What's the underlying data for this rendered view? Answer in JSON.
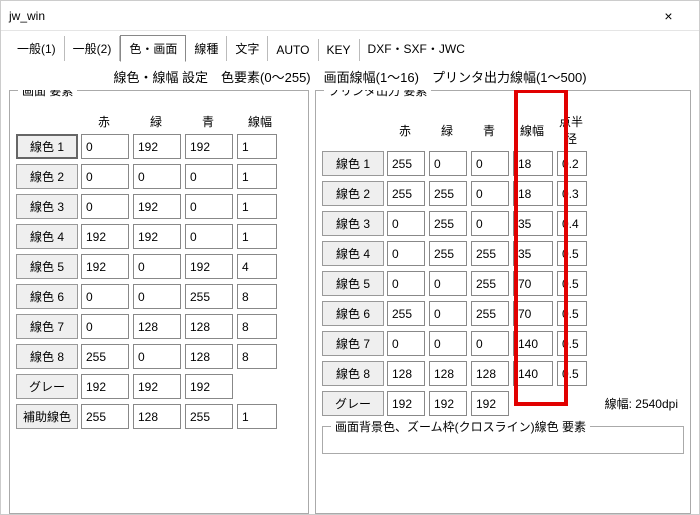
{
  "window": {
    "title": "jw_win",
    "close": "×"
  },
  "tabs": [
    {
      "label": "一般(1)",
      "active": false
    },
    {
      "label": "一般(2)",
      "active": false
    },
    {
      "label": "色・画面",
      "active": true
    },
    {
      "label": "線種",
      "active": false
    },
    {
      "label": "文字",
      "active": false
    },
    {
      "label": "AUTO",
      "active": false
    },
    {
      "label": "KEY",
      "active": false
    },
    {
      "label": "DXF・SXF・JWC",
      "active": false
    }
  ],
  "subtitle": "線色・線幅 設定　色要素(0～255)　画面線幅(1～16)　プリンタ出力線幅(1～500)",
  "screen": {
    "title": "画面 要素",
    "headers": {
      "r": "赤",
      "g": "緑",
      "b": "青",
      "lw": "線幅"
    },
    "rows": [
      {
        "label": "線色 1",
        "r": "0",
        "g": "192",
        "b": "192",
        "lw": "1",
        "selected": true
      },
      {
        "label": "線色 2",
        "r": "0",
        "g": "0",
        "b": "0",
        "lw": "1"
      },
      {
        "label": "線色 3",
        "r": "0",
        "g": "192",
        "b": "0",
        "lw": "1"
      },
      {
        "label": "線色 4",
        "r": "192",
        "g": "192",
        "b": "0",
        "lw": "1"
      },
      {
        "label": "線色 5",
        "r": "192",
        "g": "0",
        "b": "192",
        "lw": "4"
      },
      {
        "label": "線色 6",
        "r": "0",
        "g": "0",
        "b": "255",
        "lw": "8"
      },
      {
        "label": "線色 7",
        "r": "0",
        "g": "128",
        "b": "128",
        "lw": "8"
      },
      {
        "label": "線色 8",
        "r": "255",
        "g": "0",
        "b": "128",
        "lw": "8"
      }
    ],
    "gray": {
      "label": "グレー",
      "r": "192",
      "g": "192",
      "b": "192"
    },
    "assist": {
      "label": "補助線色",
      "r": "255",
      "g": "128",
      "b": "255",
      "lw": "1"
    }
  },
  "printer": {
    "title": "プリンタ出力 要素",
    "headers": {
      "r": "赤",
      "g": "緑",
      "b": "青",
      "lw": "線幅",
      "pt": "点半径"
    },
    "rows": [
      {
        "label": "線色 1",
        "r": "255",
        "g": "0",
        "b": "0",
        "lw": "18",
        "rad": "0.2"
      },
      {
        "label": "線色 2",
        "r": "255",
        "g": "255",
        "b": "0",
        "lw": "18",
        "rad": "0.3"
      },
      {
        "label": "線色 3",
        "r": "0",
        "g": "255",
        "b": "0",
        "lw": "35",
        "rad": "0.4"
      },
      {
        "label": "線色 4",
        "r": "0",
        "g": "255",
        "b": "255",
        "lw": "35",
        "rad": "0.5"
      },
      {
        "label": "線色 5",
        "r": "0",
        "g": "0",
        "b": "255",
        "lw": "70",
        "rad": "0.5"
      },
      {
        "label": "線色 6",
        "r": "255",
        "g": "0",
        "b": "255",
        "lw": "70",
        "rad": "0.5"
      },
      {
        "label": "線色 7",
        "r": "0",
        "g": "0",
        "b": "0",
        "lw": "140",
        "rad": "0.5"
      },
      {
        "label": "線色 8",
        "r": "128",
        "g": "128",
        "b": "128",
        "lw": "140",
        "rad": "0.5"
      }
    ],
    "gray": {
      "label": "グレー",
      "r": "192",
      "g": "192",
      "b": "192"
    },
    "dpi_label": "線幅:  2540dpi",
    "bg_group_title": "画面背景色、ズーム枠(クロスライン)線色 要素"
  }
}
